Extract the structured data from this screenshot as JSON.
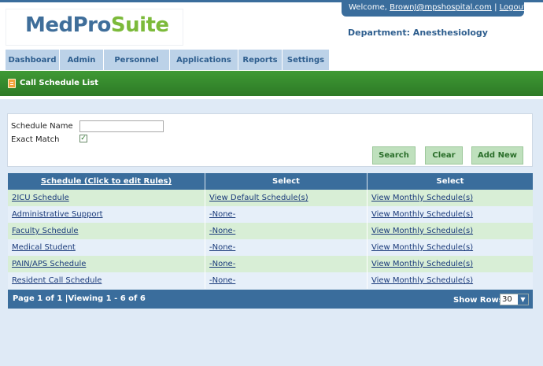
{
  "header": {
    "logo_part1": "MedPro",
    "logo_part2": "Suite",
    "welcome_text": "Welcome,",
    "user_email": "BrownJ@mpshospital.com",
    "separator": "|",
    "logout_label": "Logout",
    "department": "Department: Anesthesiology"
  },
  "nav": {
    "tabs": [
      "Dashboard",
      "Admin",
      "Personnel",
      "Applications",
      "Reports",
      "Settings"
    ]
  },
  "page": {
    "title": "Call Schedule List"
  },
  "search": {
    "schedule_name_label": "Schedule Name",
    "schedule_name_value": "",
    "exact_match_label": "Exact Match",
    "exact_match_checked": true,
    "search_button": "Search",
    "clear_button": "Clear",
    "add_new_button": "Add New"
  },
  "grid": {
    "headers": [
      "Schedule (Click to edit Rules)",
      "Select",
      "Select"
    ],
    "rows": [
      {
        "schedule": "2ICU Schedule",
        "default": "View Default Schedule(s)",
        "monthly": "View Monthly Schedule(s)"
      },
      {
        "schedule": "Administrative Support",
        "default": "-None-",
        "monthly": "View Monthly Schedule(s)"
      },
      {
        "schedule": "Faculty Schedule",
        "default": "-None-",
        "monthly": "View Monthly Schedule(s)"
      },
      {
        "schedule": "Medical Student",
        "default": "-None-",
        "monthly": "View Monthly Schedule(s)"
      },
      {
        "schedule": "PAIN/APS Schedule",
        "default": "-None-",
        "monthly": "View Monthly Schedule(s)"
      },
      {
        "schedule": "Resident Call Schedule",
        "default": "-None-",
        "monthly": "View Monthly Schedule(s)"
      }
    ],
    "footer": {
      "pager_text": "Page 1 of 1 |Viewing 1 - 6 of 6",
      "show_rows_label": "Show Rows",
      "rows_value": "30"
    }
  },
  "colors": {
    "primary_blue": "#3a6d9c",
    "nav_tab": "#bcd2e8",
    "title_bar_green": "#2d7a26",
    "button_green": "#bfe0bd",
    "row_alt": "#d8eed6",
    "row_plain": "#e6eff9",
    "logo_green": "#7cba3a"
  }
}
